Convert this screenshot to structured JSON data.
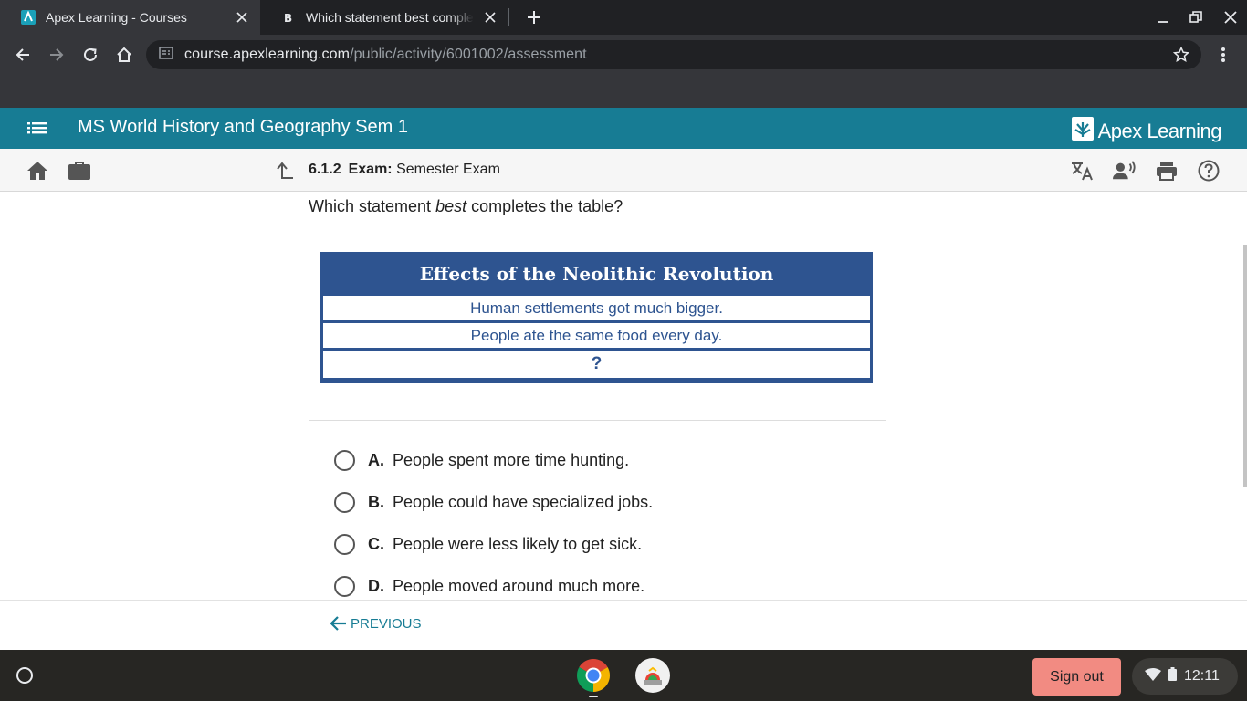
{
  "browser": {
    "tabs": [
      {
        "title": "Apex Learning - Courses",
        "active": true
      },
      {
        "title": "Which statement best completes the table?",
        "active": false
      }
    ],
    "url_host": "course.apexlearning.com",
    "url_path": "/public/activity/6001002/assessment"
  },
  "app": {
    "course_title": "MS World History and Geography Sem 1",
    "brand": "Apex Learning"
  },
  "activity": {
    "number": "6.1.2",
    "kind": "Exam:",
    "name": "Semester Exam"
  },
  "question": {
    "prefix": "Which statement ",
    "emphasis": "best",
    "suffix": " completes the table?"
  },
  "table": {
    "title": "Effects of the Neolithic Revolution",
    "rows": [
      "Human settlements got much bigger.",
      "People ate the same food every day.",
      "?"
    ]
  },
  "options": [
    {
      "letter": "A.",
      "text": "People spent more time hunting."
    },
    {
      "letter": "B.",
      "text": "People could have specialized jobs."
    },
    {
      "letter": "C.",
      "text": "People were less likely to get sick."
    },
    {
      "letter": "D.",
      "text": "People moved around much more."
    }
  ],
  "footer": {
    "previous_label": "PREVIOUS"
  },
  "shelf": {
    "signout_label": "Sign out",
    "clock": "12:11"
  },
  "colors": {
    "appbar": "#177c94",
    "table_blue": "#2e5490",
    "signout": "#f28b82"
  }
}
